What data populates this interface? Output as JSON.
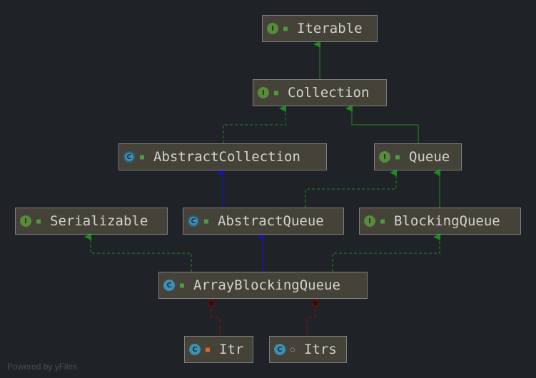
{
  "nodes": [
    {
      "id": "iterable",
      "label": "Iterable",
      "kind": "interface",
      "kind_glyph": "I",
      "visibility": "public"
    },
    {
      "id": "collection",
      "label": "Collection",
      "kind": "interface",
      "kind_glyph": "I",
      "visibility": "public"
    },
    {
      "id": "abstract-collection",
      "label": "AbstractCollection",
      "kind": "abstract-class",
      "kind_glyph": "C",
      "visibility": "public"
    },
    {
      "id": "queue",
      "label": "Queue",
      "kind": "interface",
      "kind_glyph": "I",
      "visibility": "public"
    },
    {
      "id": "serializable",
      "label": "Serializable",
      "kind": "interface",
      "kind_glyph": "I",
      "visibility": "public"
    },
    {
      "id": "abstract-queue",
      "label": "AbstractQueue",
      "kind": "abstract-class",
      "kind_glyph": "C",
      "visibility": "public"
    },
    {
      "id": "blocking-queue",
      "label": "BlockingQueue",
      "kind": "interface",
      "kind_glyph": "I",
      "visibility": "public"
    },
    {
      "id": "array-blocking-queue",
      "label": "ArrayBlockingQueue",
      "kind": "class",
      "kind_glyph": "C",
      "visibility": "public"
    },
    {
      "id": "itr",
      "label": "Itr",
      "kind": "class",
      "kind_glyph": "C",
      "visibility": "private"
    },
    {
      "id": "itrs",
      "label": "Itrs",
      "kind": "class",
      "kind_glyph": "C",
      "visibility": "package"
    }
  ],
  "edges": [
    {
      "from": "collection",
      "to": "iterable",
      "type": "extends"
    },
    {
      "from": "abstract-collection",
      "to": "collection",
      "type": "implements"
    },
    {
      "from": "queue",
      "to": "collection",
      "type": "extends"
    },
    {
      "from": "abstract-queue",
      "to": "abstract-collection",
      "type": "class-extends"
    },
    {
      "from": "abstract-queue",
      "to": "queue",
      "type": "implements"
    },
    {
      "from": "blocking-queue",
      "to": "queue",
      "type": "extends"
    },
    {
      "from": "array-blocking-queue",
      "to": "serializable",
      "type": "implements"
    },
    {
      "from": "array-blocking-queue",
      "to": "abstract-queue",
      "type": "class-extends"
    },
    {
      "from": "array-blocking-queue",
      "to": "blocking-queue",
      "type": "implements"
    },
    {
      "from": "itr",
      "to": "array-blocking-queue",
      "type": "inner-class"
    },
    {
      "from": "itrs",
      "to": "array-blocking-queue",
      "type": "inner-class"
    }
  ],
  "colors": {
    "extends": "#1f8a1f",
    "implements": "#1f8a1f",
    "class-extends": "#1515a8",
    "inner-class": "#6a1414",
    "background": "#1f2328",
    "node_fill": "#45423a"
  },
  "footer": "Powered by yFiles"
}
